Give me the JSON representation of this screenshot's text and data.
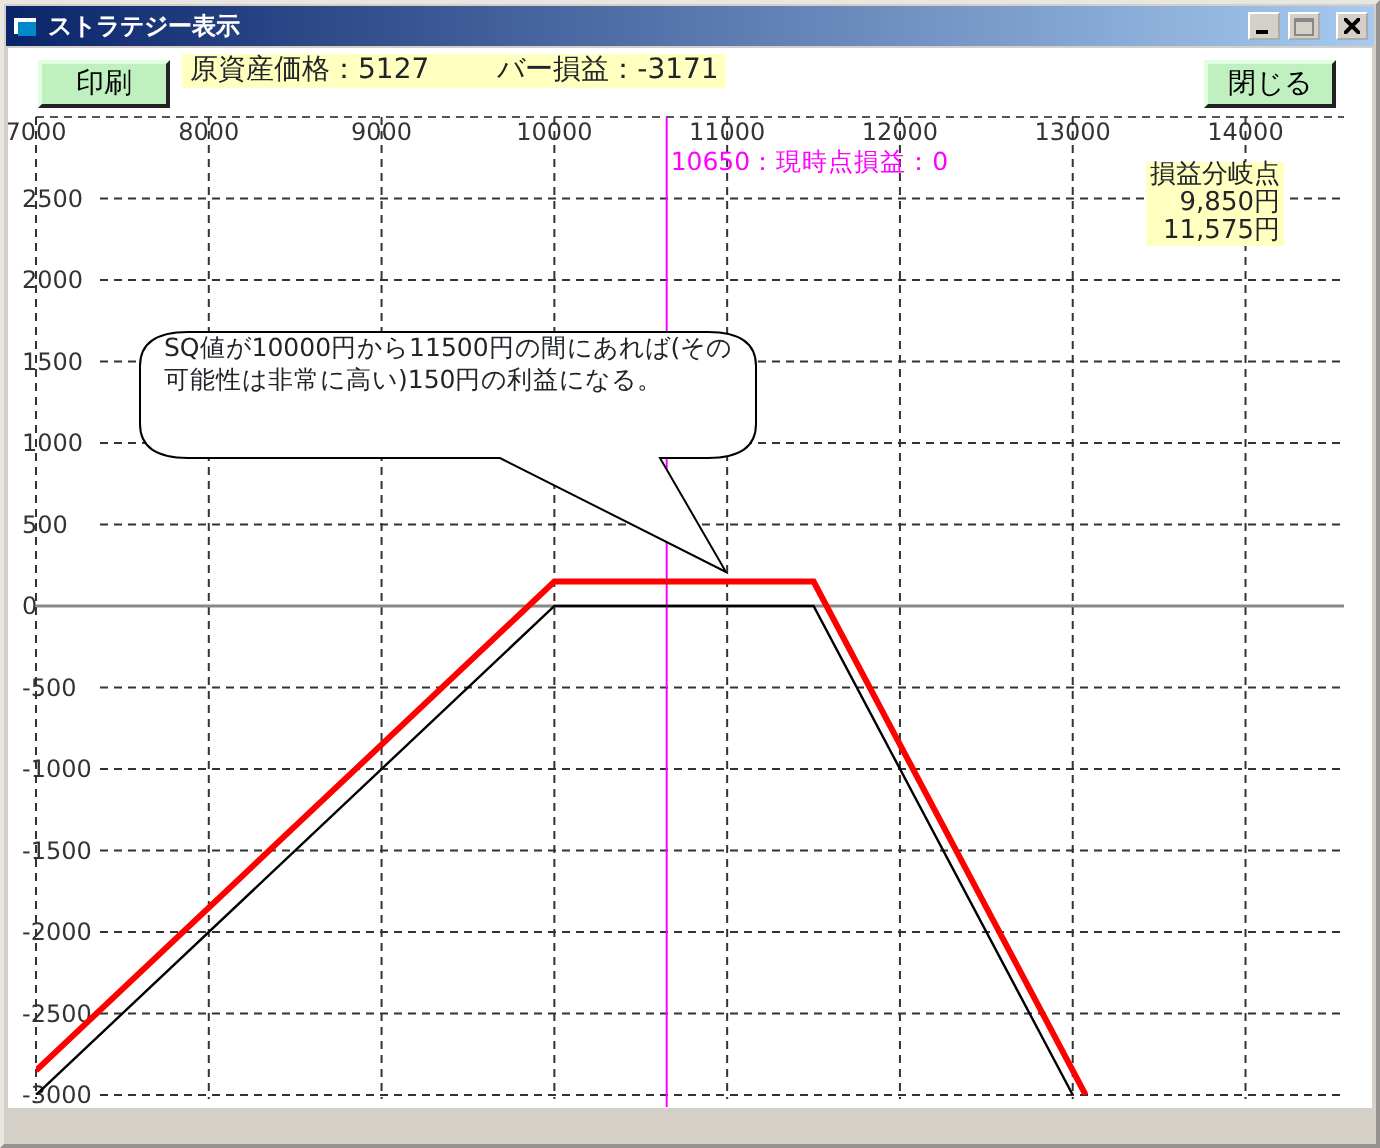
{
  "window": {
    "title": "ストラテジー表示"
  },
  "toolbar": {
    "print_button": "印刷",
    "price": "原資産価格：5127",
    "bar_pl": "バー損益：-3171",
    "close_button": "閉じる"
  },
  "chart": {
    "callout": "SQ値が10000円から11500円の間にあれば(その可能性は非常に高い)150円の利益になる。",
    "breakeven": {
      "title": "損益分岐点",
      "values": [
        "9,850円",
        "11,575円"
      ]
    },
    "chart_data": {
      "type": "line",
      "grid": true,
      "x": [
        7000,
        10000,
        11500,
        13000,
        13075
      ],
      "series": [
        {
          "color": "#ff0000",
          "values": [
            -2850,
            150,
            150,
            -2850,
            -3000
          ]
        },
        {
          "color": "#000000",
          "values": [
            -3000,
            0,
            0,
            -3000,
            null
          ]
        }
      ],
      "xlim": [
        7000,
        14570
      ],
      "ylim": [
        -3000,
        3000
      ],
      "xticks": [
        7000,
        8000,
        9000,
        10000,
        11000,
        12000,
        13000,
        14000
      ],
      "yticks": [
        2500,
        2000,
        1500,
        1000,
        500,
        0,
        -500,
        -1000,
        -1500,
        -2000,
        -2500,
        -3000
      ],
      "ref_lines": [
        {
          "axis": "x",
          "value": 10650,
          "label": "10650：現時点損益：0",
          "color": "#ff00ff"
        }
      ]
    }
  }
}
